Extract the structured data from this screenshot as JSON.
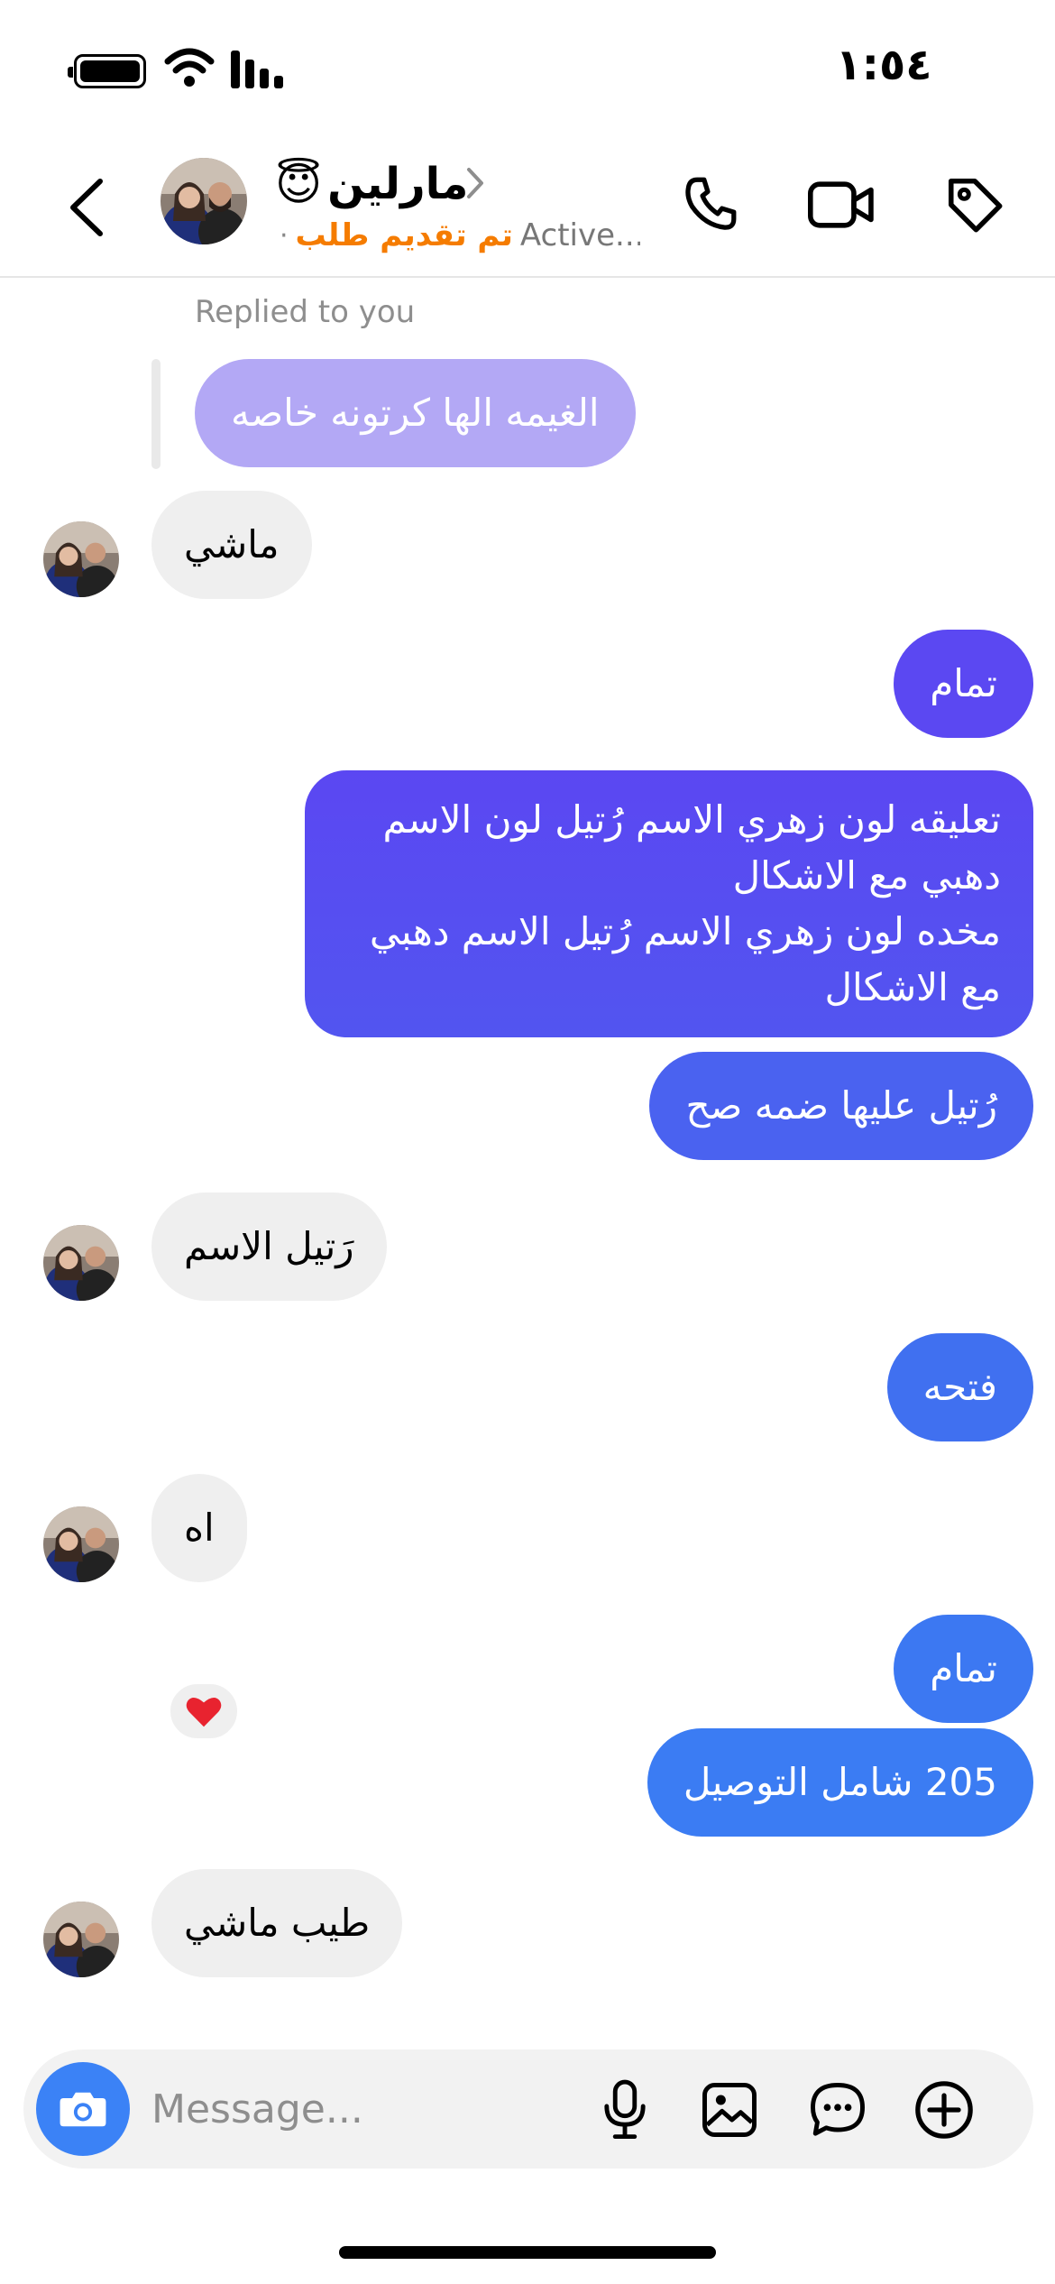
{
  "status_bar": {
    "time": "١:٥٤"
  },
  "header": {
    "contact_name": "مارلين",
    "contact_emoji": "😇",
    "subtitle_active": "Active...",
    "subtitle_status": "تم تقديم طلب",
    "subtitle_separator": "·"
  },
  "chat": {
    "replied_label": "Replied to you",
    "messages": [
      {
        "id": "m1",
        "direction": "outgoing-reply-quote",
        "text": "الغيمه الها كرتونه خاصه"
      },
      {
        "id": "m2",
        "direction": "incoming",
        "text": "ماشي"
      },
      {
        "id": "m3",
        "direction": "outgoing",
        "text": "تمام"
      },
      {
        "id": "m4",
        "direction": "outgoing",
        "lines": [
          "تعليقه لون زهري الاسم رُتيل لون الاسم",
          "دهبي مع الاشكال",
          "مخده لون زهري الاسم رُتيل الاسم دهبي",
          "مع الاشكال"
        ]
      },
      {
        "id": "m5",
        "direction": "outgoing",
        "text": "رُتيل عليها ضمه صح"
      },
      {
        "id": "m6",
        "direction": "incoming",
        "text": "رَتيل الاسم"
      },
      {
        "id": "m7",
        "direction": "outgoing",
        "text": "فتحه"
      },
      {
        "id": "m8",
        "direction": "incoming",
        "text": "اه"
      },
      {
        "id": "m9",
        "direction": "outgoing",
        "text": "تمام"
      },
      {
        "id": "m10",
        "direction": "outgoing",
        "text": "205 شامل التوصيل"
      },
      {
        "id": "m11",
        "direction": "incoming",
        "text": "طيب ماشي",
        "reaction": "❤️"
      }
    ]
  },
  "composer": {
    "placeholder": "Message..."
  },
  "colors": {
    "accent_purple": "#5a4ef0",
    "accent_blue": "#3b82f6",
    "status_orange": "#f57c00",
    "incoming_bubble": "#efefef"
  },
  "icons": [
    "back-icon",
    "phone-icon",
    "video-camera-icon",
    "tag-icon",
    "camera-icon",
    "microphone-icon",
    "gallery-icon",
    "sticker-icon",
    "plus-icon",
    "heart-icon"
  ]
}
